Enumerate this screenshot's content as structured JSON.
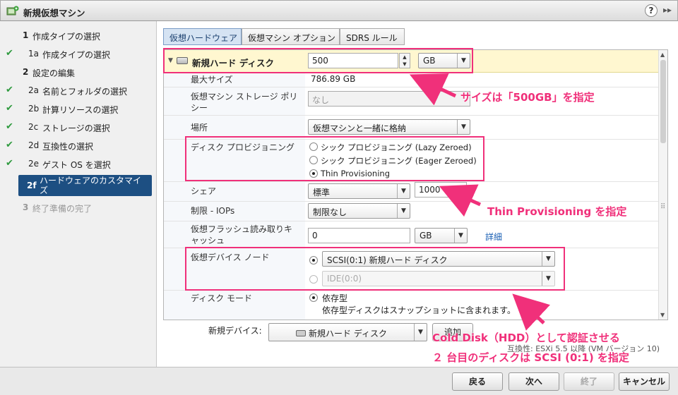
{
  "window": {
    "title": "新規仮想マシン"
  },
  "nav": {
    "steps": [
      {
        "num": "1",
        "label": "作成タイプの選択",
        "done": false
      },
      {
        "num": "1a",
        "label": "作成タイプの選択",
        "done": true
      },
      {
        "num": "2",
        "label": "設定の編集",
        "done": false
      },
      {
        "num": "2a",
        "label": "名前とフォルダの選択",
        "done": true
      },
      {
        "num": "2b",
        "label": "計算リソースの選択",
        "done": true
      },
      {
        "num": "2c",
        "label": "ストレージの選択",
        "done": true
      },
      {
        "num": "2d",
        "label": "互換性の選択",
        "done": true
      },
      {
        "num": "2e",
        "label": "ゲスト OS を選択",
        "done": true
      },
      {
        "num": "2f",
        "label": "ハードウェアのカスタマイズ",
        "active": true
      },
      {
        "num": "3",
        "label": "終了準備の完了",
        "disabled": true
      }
    ]
  },
  "tabs": [
    "仮想ハードウェア",
    "仮想マシン オプション",
    "SDRS ルール"
  ],
  "disk": {
    "title": "新規ハード ディスク",
    "size_value": "500",
    "size_unit": "GB",
    "rows": {
      "max_size": {
        "label": "最大サイズ",
        "value": "786.89 GB"
      },
      "storage_policy": {
        "label": "仮想マシン ストレージ ポリシー",
        "value": "なし"
      },
      "location": {
        "label": "場所",
        "value": "仮想マシンと一緒に格納"
      },
      "provisioning": {
        "label": "ディスク プロビジョニング",
        "options": [
          "シック プロビジョニング (Lazy Zeroed)",
          "シック プロビジョニング (Eager Zeroed)",
          "Thin Provisioning"
        ],
        "selected": "Thin Provisioning"
      },
      "shares": {
        "label": "シェア",
        "level": "標準",
        "value": "1000"
      },
      "iops": {
        "label": "制限 - IOPs",
        "value": "制限なし"
      },
      "flash_cache": {
        "label": "仮想フラッシュ読み取りキャッシュ",
        "value": "0",
        "unit": "GB",
        "link": "詳細"
      },
      "device_node": {
        "label": "仮想デバイス ノード",
        "scsi": "SCSI(0:1) 新規ハード ディスク",
        "ide": "IDE(0:0)"
      },
      "disk_mode": {
        "label": "ディスク モード",
        "option": "依存型",
        "note": "依存型ディスクはスナップショットに含まれます。"
      }
    }
  },
  "new_device": {
    "label": "新規デバイス:",
    "value": "新規ハード ディスク",
    "add": "追加",
    "compat": "互換性: ESXi 5.5 以降 (VM バージョン 10)"
  },
  "buttons": {
    "back": "戻る",
    "next": "次へ",
    "finish": "終了",
    "cancel": "キャンセル"
  },
  "annotations": {
    "size": "サイズは「500GB」を指定",
    "thin": "Thin Provisioning を指定",
    "cold_line1": "Cold Disk（HDD）として認証させる",
    "cold_line2": "２ 台目のディスクは SCSI (0:1) を指定"
  },
  "colors": {
    "accent": "#f0307a",
    "nav_active": "#1d4f82",
    "header_row": "#fff7d0",
    "tab_selected": "#d5e3f3"
  }
}
